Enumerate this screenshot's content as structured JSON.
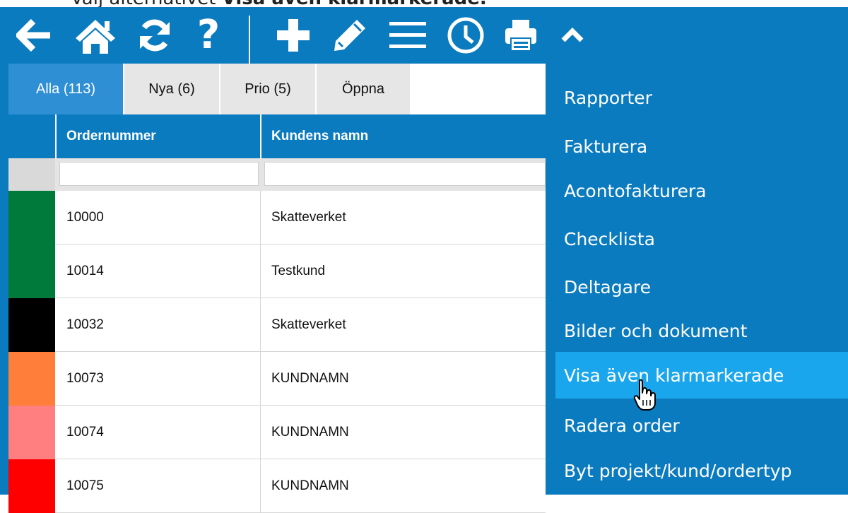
{
  "caption": {
    "prefix": "Välj alternativet ",
    "bold": "Visa även klarmarkerade."
  },
  "toolbar": {
    "icons": [
      "back-arrow-icon",
      "home-icon",
      "refresh-icon",
      "help-icon",
      "plus-icon",
      "pencil-icon",
      "menu-icon",
      "clock-icon",
      "printer-icon",
      "chevron-up-icon"
    ],
    "help_glyph": "?"
  },
  "tabs": [
    {
      "label": "Alla (113)",
      "active": true
    },
    {
      "label": "Nya (6)",
      "active": false
    },
    {
      "label": "Prio (5)",
      "active": false
    },
    {
      "label": "Öppna",
      "active": false
    }
  ],
  "table": {
    "headers": {
      "order": "Ordernummer",
      "customer": "Kundens namn"
    },
    "filters": {
      "order": "",
      "customer": ""
    },
    "rows": [
      {
        "color": "#007a3a",
        "order": "10000",
        "customer": "Skatteverket"
      },
      {
        "color": "#007a3a",
        "order": "10014",
        "customer": "Testkund"
      },
      {
        "color": "#000000",
        "order": "10032",
        "customer": "Skatteverket"
      },
      {
        "color": "#ff7f3a",
        "order": "10073",
        "customer": "KUNDNAMN"
      },
      {
        "color": "#ff7f80",
        "order": "10074",
        "customer": "KUNDNAMN"
      },
      {
        "color": "#ff0000",
        "order": "10075",
        "customer": "KUNDNAMN"
      }
    ]
  },
  "menu": {
    "items": [
      {
        "label": "Rapporter"
      },
      {
        "label": "Fakturera"
      },
      {
        "label": "Acontofakturera"
      },
      {
        "label": "Checklista"
      },
      {
        "label": "Deltagare"
      },
      {
        "label": "Bilder och dokument"
      },
      {
        "label": "Visa även klarmarkerade",
        "highlighted": true
      },
      {
        "label": "Radera order"
      },
      {
        "label": "Byt projekt/kund/ordertyp"
      }
    ]
  },
  "colors": {
    "toolbar": "#0b7bbf",
    "active_tab": "#2f8fd5",
    "menu_highlight": "#1aa6ec"
  }
}
